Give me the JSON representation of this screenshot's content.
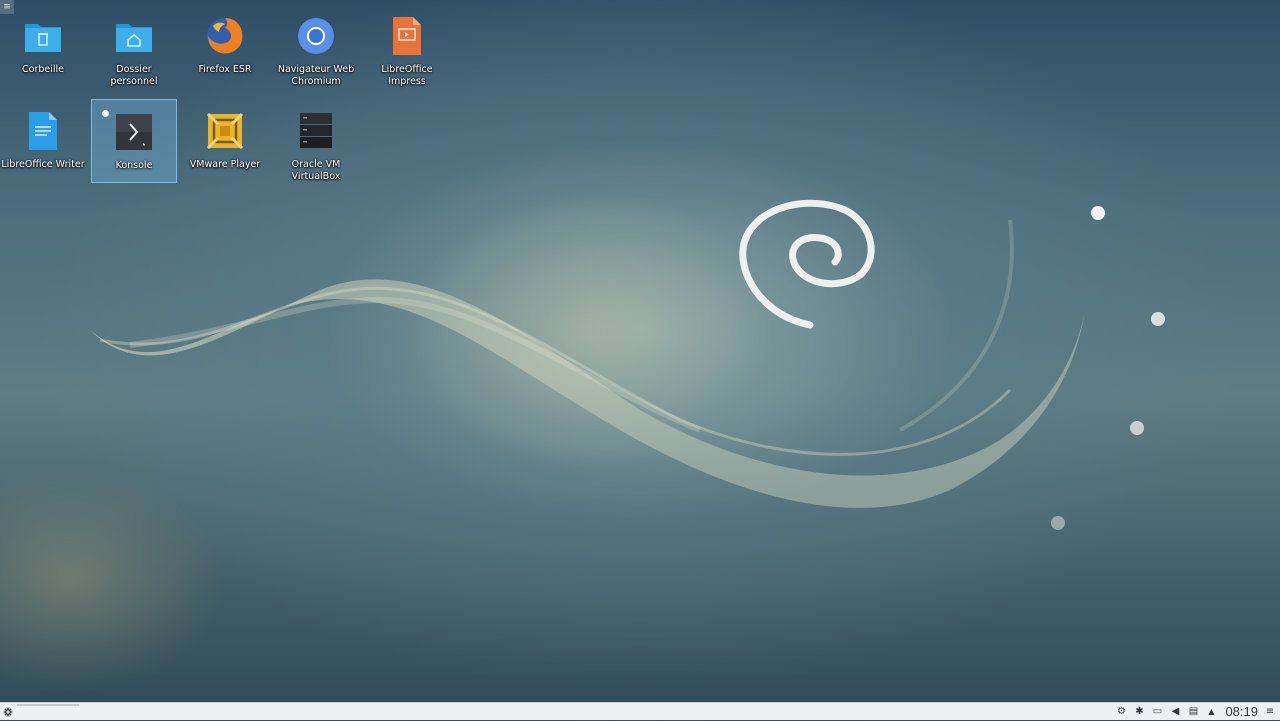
{
  "desktop": {
    "icons": [
      {
        "name": "trash",
        "label": "Corbeille",
        "icon": "trash-folder-icon"
      },
      {
        "name": "home-folder",
        "label": "Dossier personnel",
        "icon": "home-folder-icon"
      },
      {
        "name": "firefox",
        "label": "Firefox ESR",
        "icon": "firefox-icon"
      },
      {
        "name": "chromium",
        "label": "Navigateur Web Chromium",
        "icon": "chromium-icon"
      },
      {
        "name": "impress",
        "label": "LibreOffice Impress",
        "icon": "libreoffice-impress-icon"
      },
      {
        "name": "writer",
        "label": "LibreOffice Writer",
        "icon": "libreoffice-writer-icon"
      },
      {
        "name": "konsole",
        "label": "Konsole",
        "icon": "terminal-icon",
        "selected": true
      },
      {
        "name": "vmware",
        "label": "VMware Player",
        "icon": "vmware-icon"
      },
      {
        "name": "virtualbox",
        "label": "Oracle VM VirtualBox",
        "icon": "virtualbox-icon"
      }
    ],
    "corner_button": "≡"
  },
  "taskbar": {
    "launcher_icon": "kde-menu-icon",
    "tray": [
      {
        "name": "updates",
        "icon": "update-icon",
        "glyph": "⚙"
      },
      {
        "name": "bluetooth",
        "icon": "bluetooth-icon",
        "glyph": "✱"
      },
      {
        "name": "network",
        "icon": "network-icon",
        "glyph": "▭"
      },
      {
        "name": "volume",
        "icon": "volume-icon",
        "glyph": "◀"
      },
      {
        "name": "clipboard",
        "icon": "clipboard-icon",
        "glyph": "▤"
      },
      {
        "name": "tray-expand",
        "icon": "chevron-up-icon",
        "glyph": "▲"
      }
    ],
    "clock": "08:19",
    "menu_glyph": "≡"
  },
  "colors": {
    "folder_blue": "#3daee9",
    "selection": "#6eaad2",
    "impress_orange": "#e8733a"
  }
}
